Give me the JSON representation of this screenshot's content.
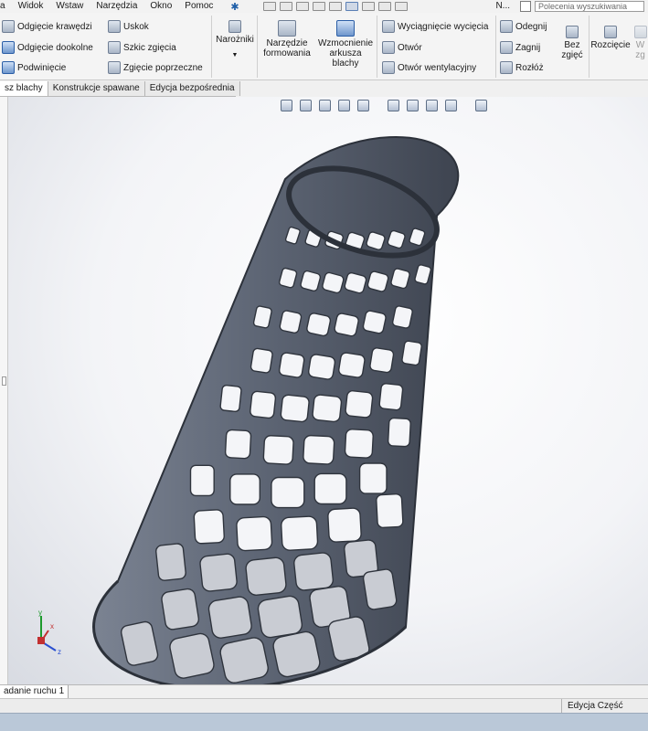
{
  "menubar": {
    "items": [
      "a",
      "Widok",
      "Wstaw",
      "Narzędzia",
      "Okno",
      "Pomoc"
    ],
    "command_search_placeholder": "Polecenia wyszukiwania",
    "truncated_label": "N..."
  },
  "ribbon": {
    "col1": [
      "Odgięcie krawędzi",
      "Odgięcie dookolne",
      "Podwinięcie"
    ],
    "col2": [
      "Uskok",
      "Szkic zgięcia",
      "Zgięcie poprzeczne"
    ],
    "corners": "Narożniki",
    "forming_tool": [
      "Narzędzie",
      "formowania"
    ],
    "sheet_gusset": [
      "Wzmocnienie",
      "arkusza",
      "blachy"
    ],
    "col3": [
      "Wyciągnięcie wycięcia",
      "Otwór",
      "Otwór wentylacyjny"
    ],
    "col4": [
      "Odegnij",
      "Zagnij",
      "Rozłóż"
    ],
    "no_bends": [
      "Bez",
      "zgięć"
    ],
    "rip": "Rozcięcie",
    "cut_label": [
      "W",
      "zg"
    ]
  },
  "tabs": [
    "sz blachy",
    "Konstrukcje spawane",
    "Edycja bezpośrednia"
  ],
  "bottom": {
    "motion_tab": "adanie ruchu 1",
    "status": "Edycja Część"
  },
  "triad": {
    "x": "x",
    "y": "y",
    "z": "z"
  },
  "colors": {
    "accent": "#1f5fa8",
    "model": "#5e6675",
    "model_dark": "#343a45"
  }
}
